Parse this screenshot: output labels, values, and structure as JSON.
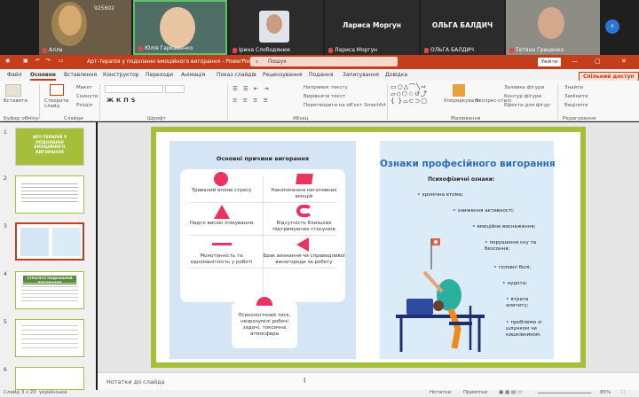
{
  "meeting": {
    "participants": [
      {
        "name": "Алла",
        "code": "925602"
      },
      {
        "name": "Юлія Гаркавенко"
      },
      {
        "name": "Ірина Слободянюк"
      },
      {
        "name": "Лариса Моргун",
        "label": "Лариса Моргун"
      },
      {
        "name": "ОЛЬГА БАЛДИЧ",
        "label": "ОЛЬГА БАЛДИЧ"
      },
      {
        "name": "Тетяна Гриценко"
      }
    ],
    "next_arrow": "›"
  },
  "titlebar": {
    "title": "Арт-терапія у подоланні емоційного вигорання - PowerPoint",
    "search_placeholder": "Пошук",
    "signin_label": "Увійти"
  },
  "tabs": {
    "items": [
      "Файл",
      "Основне",
      "Вставлення",
      "Конструктор",
      "Переходи",
      "Анімація",
      "Показ слайдів",
      "Рецензування",
      "Подання",
      "Записування",
      "Довідка"
    ],
    "share_label": "Спільний доступ"
  },
  "ribbon": {
    "paste": "Вставити",
    "clipboard": "Буфер обміну",
    "new_slide": "Створити слайд",
    "slides": "Слайди",
    "layout": "Макет",
    "reset": "Скинути",
    "section": "Розділ",
    "font": "Шрифт",
    "paragraph": "Абзац",
    "text_direction": "Напрямок тексту",
    "align_text": "Вирівняти текст",
    "smartart": "Перетворити на об'єкт SmartArt",
    "drawing": "Малювання",
    "arrange": "Упорядкувати",
    "quick_styles": "Експрес-стилі",
    "shape_fill": "Заливка фігури",
    "shape_outline": "Контур фігури",
    "shape_effects": "Ефекти для фігур",
    "find": "Знайти",
    "replace": "Замінити",
    "select": "Виділити",
    "editing": "Редагування"
  },
  "slide_panel": {
    "thumb1_title": "АРТ-ТЕРАПІЯ У ПОДОЛАННІ ЕМОЦІЙНОГО ВИГОРАННЯ",
    "thumb4_title": "СТРАТЕГІЇ ПОДОЛАННЯ ВИГОРАННЯ",
    "numbers": [
      "1",
      "2",
      "3",
      "4",
      "5",
      "6"
    ]
  },
  "slide": {
    "left_heading": "Основні причини вигорання",
    "causes": [
      "Тривалий вплив стресу",
      "Накопичення негативних емоцій",
      "Надто високі очікування",
      "Відсутність близьких підтримуючих стосунків",
      "Монотонність та одноманітність у роботі",
      "Брак визнання чи справедливої винагороди за роботу"
    ],
    "extra_cause": "Психологічний тиск, незрозумілі робочі задачі, токсична атмосфера",
    "right_title": "Ознаки професійного вигорання",
    "signs_heading": "Психофізичні ознаки:",
    "signs": [
      "хронічна втома;",
      "зниження активності;",
      "емоційне виснаження;",
      "порушення сну та безсоння;",
      "головні болі;",
      "нудота;",
      "втрата апетиту;",
      "проблеми зі шлунком чи кишківником."
    ]
  },
  "notes": {
    "placeholder": "Нотатки до слайда"
  },
  "statusbar": {
    "slide_info": "Слайд 3 з 20",
    "language": "українська",
    "notes": "Нотатки",
    "comments": "Примітки",
    "zoom": "85%"
  },
  "colors": {
    "accent": "#c43e1c",
    "slide_border": "#a6bf3b",
    "title_blue": "#2e6db4",
    "shape_pink": "#e8345f"
  }
}
